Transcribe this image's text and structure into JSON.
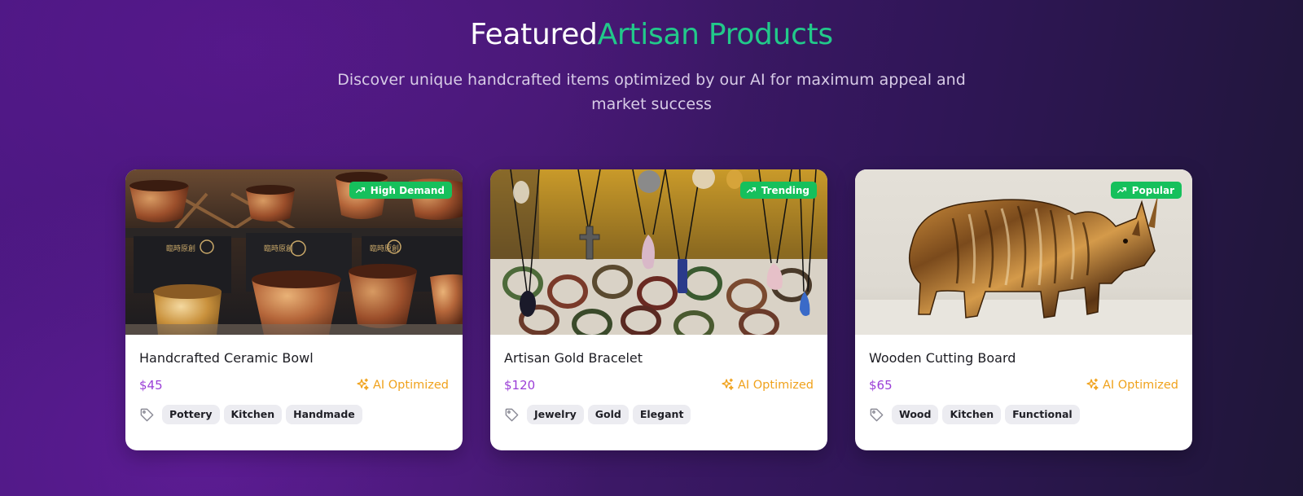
{
  "section": {
    "title_part1": "Featured",
    "title_part2": "Artisan Products",
    "subtitle": "Discover unique handcrafted items optimized by our AI for maximum appeal and market success"
  },
  "colors": {
    "accent_green": "#22c98a",
    "price_purple": "#9b3fd7",
    "ai_orange": "#f0a21c",
    "badge_green": "#16c05c"
  },
  "products": [
    {
      "title": "Handcrafted Ceramic Bowl",
      "price": "$45",
      "badge": "High Demand",
      "ai_label": "AI Optimized",
      "tags": [
        "Pottery",
        "Kitchen",
        "Handmade"
      ],
      "image_icon": "ceramic-bowls-photo"
    },
    {
      "title": "Artisan Gold Bracelet",
      "price": "$120",
      "badge": "Trending",
      "ai_label": "AI Optimized",
      "tags": [
        "Jewelry",
        "Gold",
        "Elegant"
      ],
      "image_icon": "pendant-necklaces-photo"
    },
    {
      "title": "Wooden Cutting Board",
      "price": "$65",
      "badge": "Popular",
      "ai_label": "AI Optimized",
      "tags": [
        "Wood",
        "Kitchen",
        "Functional"
      ],
      "image_icon": "wooden-rhino-photo"
    }
  ]
}
